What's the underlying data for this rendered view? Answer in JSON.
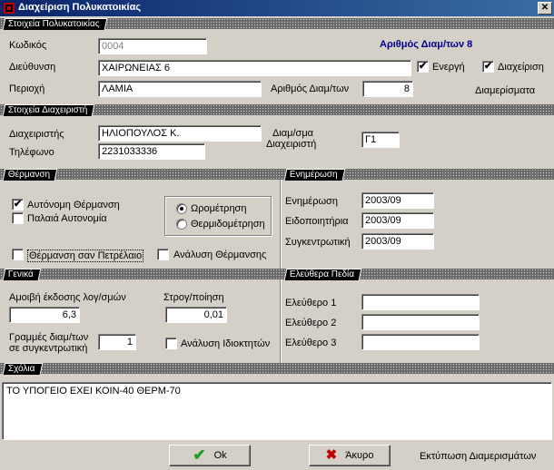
{
  "window": {
    "title": "Διαχείριση Πολυκατοικίας",
    "close_glyph": "✕"
  },
  "building": {
    "section_label": "Στοιχεία Πολυκατοικίας",
    "code_label": "Κωδικός",
    "code_value": "0004",
    "apartments_count_header": "Αριθμός Διαμ/των  8",
    "address_label": "Διεύθυνση",
    "address_value": "ΧΑΙΡΩΝΕΙΑΣ  6",
    "active_label": "Ενεργή",
    "active_checked": true,
    "management_label": "Διαχείριση",
    "management_checked": true,
    "area_label": "Περιοχή",
    "area_value": "ΛΑΜΙΑ",
    "apartments_count_label": "Αριθμός Διαμ/των",
    "apartments_count_value": "8",
    "apartments_link": "Διαμερίσματα"
  },
  "manager": {
    "section_label": "Στοιχεία Διαχειριστή",
    "name_label": "Διαχειριστής",
    "name_value": "ΗΛΙΟΠΟΥΛΟΣ Κ.",
    "phone_label": "Τηλέφωνο",
    "phone_value": "2231033336",
    "apartment_label_1": "Διαμ/σμα",
    "apartment_label_2": "Διαχειριστή",
    "apartment_value": "Γ1"
  },
  "heating": {
    "section_label": "Θέρμανση",
    "autonomous_label": "Αυτόνομη Θέρμανση",
    "autonomous_checked": true,
    "old_autonomy_label": "Παλαιά Αυτονομία",
    "old_autonomy_checked": false,
    "hour_meter_label": "Ωρομέτρηση",
    "hour_meter_selected": true,
    "heat_meter_label": "Θερμιδομέτρηση",
    "heat_meter_selected": false,
    "oil_label": "Θέρμανση σαν Πετρέλαιο",
    "oil_checked": false,
    "analysis_label": "Ανάλυση Θέρμανσης",
    "analysis_checked": false
  },
  "update": {
    "section_label": "Ενημέρωση",
    "update_label": "Ενημέρωση",
    "update_value": "2003/09",
    "notices_label": "Ειδοποιητήρια",
    "notices_value": "2003/09",
    "summary_label": "Συγκεντρωτική",
    "summary_value": "2003/09"
  },
  "general": {
    "section_label": "Γενικά",
    "fee_label": "Αμοιβή έκδοσης λογ/σμών",
    "fee_value": "6,3",
    "rounding_label": "Στρογ/ποίηση",
    "rounding_value": "0,01",
    "lines_label_1": "Γραμμές διαμ/των",
    "lines_label_2": "σε συγκεντρωτική",
    "lines_value": "1",
    "owner_analysis_label": "Ανάλυση Ιδιοκτητών",
    "owner_analysis_checked": false
  },
  "free_fields": {
    "section_label": "Ελεύθερα Πεδία",
    "field1_label": "Ελεύθερο 1",
    "field1_value": "",
    "field2_label": "Ελεύθερο 2",
    "field2_value": "",
    "field3_label": "Ελεύθερο 3",
    "field3_value": ""
  },
  "notes": {
    "section_label": "Σχόλια",
    "text": "ΤΟ ΥΠΟΓΕΙΟ ΕΧΕΙ ΚΟΙΝ-40  ΘΕΡΜ-70"
  },
  "buttons": {
    "ok_label": "Ok",
    "cancel_label": "Άκυρο",
    "print_label": "Εκτύπωση Διαμερισμάτων"
  },
  "colors": {
    "accent_blue": "#00008b",
    "ok_green": "#1e9e1e",
    "cancel_red": "#c00000"
  }
}
